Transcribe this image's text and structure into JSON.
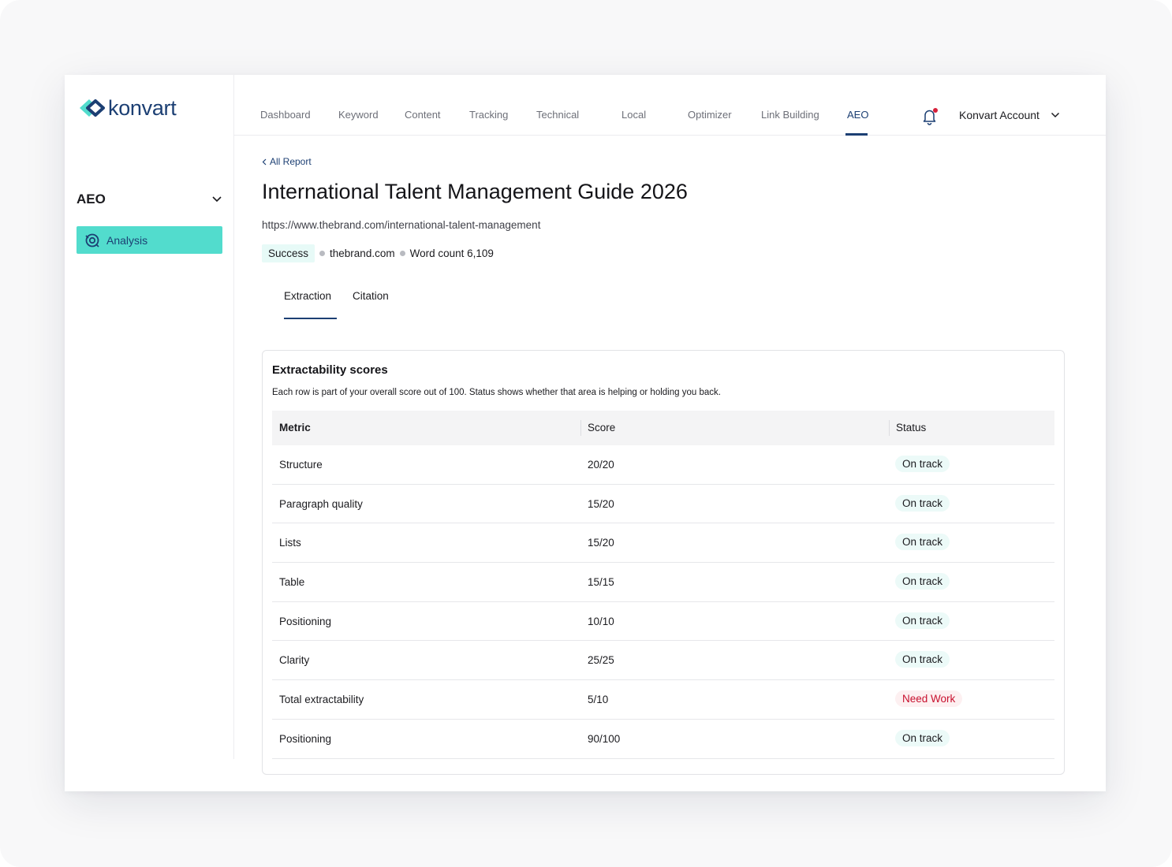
{
  "brand": {
    "name": "konvart",
    "colors": {
      "primary": "#1c3f73",
      "accent": "#52dccd",
      "danger": "#c8102e"
    }
  },
  "sidebar": {
    "group_label": "AEO",
    "items": [
      {
        "label": "Analysis",
        "icon": "analysis-icon",
        "active": true
      }
    ]
  },
  "topnav": {
    "items": [
      {
        "label": "Dashboard"
      },
      {
        "label": "Keyword"
      },
      {
        "label": "Content"
      },
      {
        "label": "Tracking"
      },
      {
        "label": "Technical"
      },
      {
        "label": "Local"
      },
      {
        "label": "Optimizer"
      },
      {
        "label": "Link Building"
      },
      {
        "label": "AEO",
        "active": true
      }
    ],
    "notification_icon": "bell-icon",
    "account_label": "Konvart Account"
  },
  "page": {
    "back_label": "All Report",
    "title": "International Talent Management Guide 2026",
    "url": "https://www.thebrand.com/international-talent-management",
    "status_badge": "Success",
    "domain": "thebrand.com",
    "word_count": "Word count 6,109"
  },
  "tabs": [
    {
      "label": "Extraction",
      "active": true
    },
    {
      "label": "Citation"
    }
  ],
  "card": {
    "title": "Extractability scores",
    "subtitle": "Each row is part of your overall score out of 100. Status shows whether that area is helping or holding you back.",
    "columns": [
      "Metric",
      "Score",
      "Status"
    ],
    "rows": [
      {
        "metric": "Structure",
        "score": "20/20",
        "status": "On track"
      },
      {
        "metric": "Paragraph quality",
        "score": "15/20",
        "status": "On track"
      },
      {
        "metric": "Lists",
        "score": "15/20",
        "status": "On track"
      },
      {
        "metric": "Table",
        "score": "15/15",
        "status": "On track"
      },
      {
        "metric": "Positioning",
        "score": "10/10",
        "status": "On track"
      },
      {
        "metric": "Clarity",
        "score": "25/25",
        "status": "On track"
      },
      {
        "metric": "Total extractability",
        "score": "5/10",
        "status": "Need Work"
      },
      {
        "metric": "Positioning",
        "score": "90/100",
        "status": "On track"
      }
    ]
  }
}
